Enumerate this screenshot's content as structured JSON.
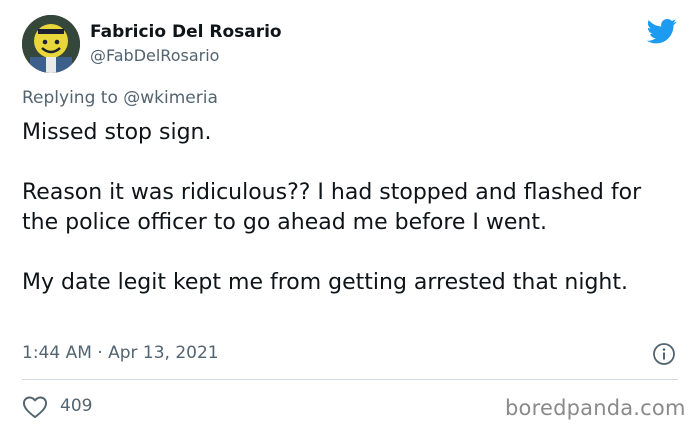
{
  "author": {
    "display_name": "Fabricio Del Rosario",
    "handle": "@FabDelRosario",
    "avatar_icon": "avatar-photo"
  },
  "reply": {
    "prefix": "Replying to",
    "to": "@wkimeria"
  },
  "tweet": {
    "paragraphs": [
      "Missed stop sign.",
      "Reason it was ridiculous?? I had stopped and flashed for the police officer to go ahead me before I went.",
      "My date legit kept me from getting arrested that night."
    ],
    "timestamp": "1:44 AM · Apr 13, 2021",
    "likes": "409"
  },
  "icons": {
    "brand": "twitter-bird-icon",
    "info": "info-icon",
    "like": "heart-icon"
  },
  "colors": {
    "twitter_blue": "#1d9bf0",
    "secondary_text": "#536471",
    "primary_text": "#0f1419"
  },
  "watermark": "boredpanda.com"
}
